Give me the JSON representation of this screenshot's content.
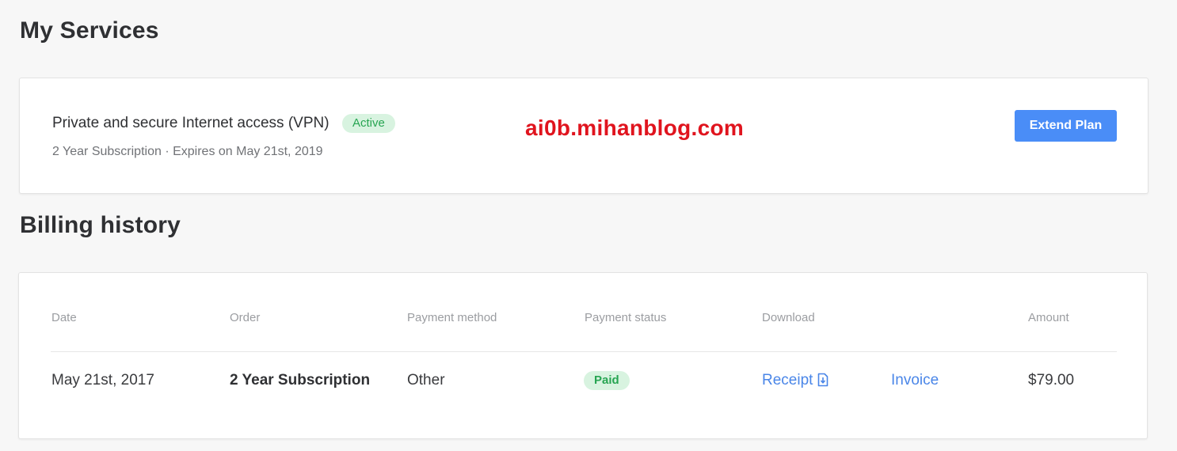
{
  "services": {
    "title": "My Services",
    "item": {
      "name": "Private and secure Internet access (VPN)",
      "status": "Active",
      "subtitle": "2 Year Subscription · Expires on May 21st, 2019",
      "action_label": "Extend Plan"
    },
    "watermark": "ai0b.mihanblog.com"
  },
  "billing": {
    "title": "Billing history",
    "columns": [
      "Date",
      "Order",
      "Payment method",
      "Payment status",
      "Download",
      "Amount"
    ],
    "rows": [
      {
        "date": "May 21st, 2017",
        "order": "2 Year Subscription",
        "payment_method": "Other",
        "payment_status": "Paid",
        "receipt_label": "Receipt",
        "invoice_label": "Invoice",
        "amount": "$79.00"
      }
    ]
  },
  "colors": {
    "accent": "#4a8df7",
    "link": "#4a86e8",
    "success_text": "#27a552",
    "success_bg": "#d8f3e0",
    "watermark": "#e0141e"
  },
  "icons": {
    "receipt": "download-file-icon"
  }
}
